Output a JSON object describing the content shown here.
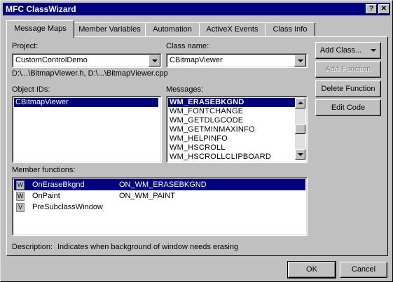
{
  "window": {
    "title": "MFC ClassWizard",
    "help_glyph": "?",
    "close_glyph": "✕"
  },
  "tabs": [
    {
      "label": "Message Maps",
      "active": true
    },
    {
      "label": "Member Variables",
      "active": false
    },
    {
      "label": "Automation",
      "active": false
    },
    {
      "label": "ActiveX Events",
      "active": false
    },
    {
      "label": "Class Info",
      "active": false
    }
  ],
  "project": {
    "label": "Project:",
    "value": "CustomControlDemo"
  },
  "class_name": {
    "label": "Class name:",
    "value": "CBitmapViewer"
  },
  "file_paths": "D:\\...\\BitmapViewer.h, D:\\...\\BitmapViewer.cpp",
  "object_ids": {
    "label": "Object IDs:",
    "items": [
      "CBitmapViewer"
    ],
    "selected": 0
  },
  "messages": {
    "label": "Messages:",
    "items": [
      "WM_ERASEBKGND",
      "WM_FONTCHANGE",
      "WM_GETDLGCODE",
      "WM_GETMINMAXINFO",
      "WM_HELPINFO",
      "WM_HSCROLL",
      "WM_HSCROLLCLIPBOARD"
    ],
    "selected": 0
  },
  "side_buttons": {
    "add_class": "Add Class...",
    "add_function": "Add Function",
    "delete_function": "Delete Function",
    "edit_code": "Edit Code"
  },
  "member_functions": {
    "label": "Member functions:",
    "rows": [
      {
        "icon": "W",
        "name": "OnEraseBkgnd",
        "handler": "ON_WM_ERASEBKGND",
        "selected": true
      },
      {
        "icon": "W",
        "name": "OnPaint",
        "handler": "ON_WM_PAINT",
        "selected": false
      },
      {
        "icon": "V",
        "name": "PreSubclassWindow",
        "handler": "",
        "selected": false
      }
    ]
  },
  "description": {
    "label": "Description:",
    "text": "Indicates when background of window needs erasing"
  },
  "footer": {
    "ok": "OK",
    "cancel": "Cancel"
  }
}
